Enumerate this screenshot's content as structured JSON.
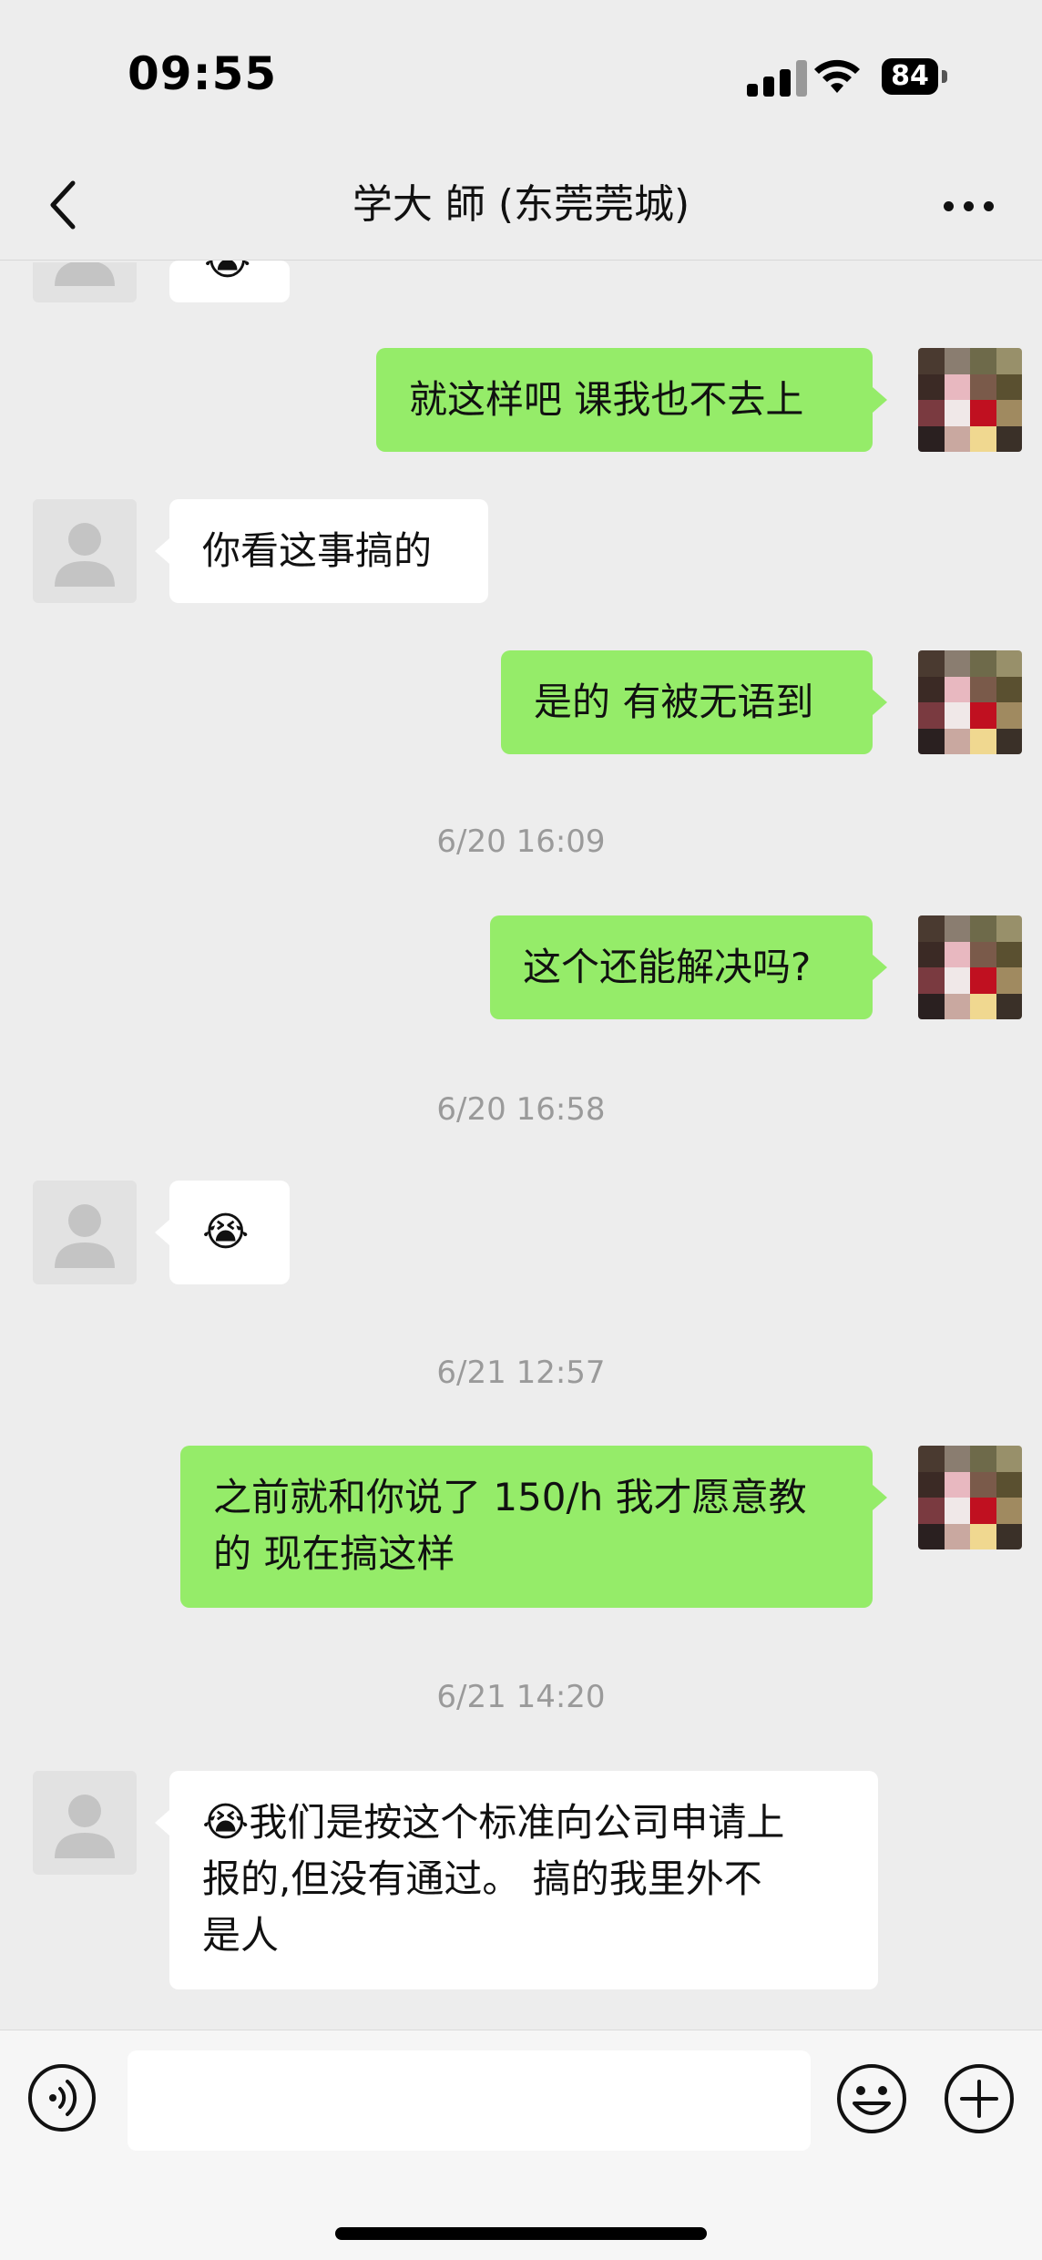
{
  "status_bar": {
    "time": "09:55",
    "battery": "84"
  },
  "nav": {
    "title": "学大 師 (东莞莞城)"
  },
  "messages": {
    "m0_emoji": "😭",
    "m1": "就这样吧 课我也不去上",
    "m2": "你看这事搞的",
    "m3": "是的 有被无语到",
    "ts1": "6/20 16:09",
    "m4": "这个还能解决吗?",
    "ts2": "6/20 16:58",
    "m5_emoji": "😭",
    "ts3": "6/21 12:57",
    "m6_line1": "之前就和你说了 150/h 我才愿意教",
    "m6_line2": "的 现在搞这样",
    "ts4": "6/21 14:20",
    "m7_emoji": "😭",
    "m7_line1": "我们是按这个标准向公司申请上",
    "m7_line2": "报的,但没有通过。 搞的我里外不",
    "m7_line3": "是人"
  },
  "input": {
    "placeholder": ""
  },
  "icons": {
    "back": "chevron-left-icon",
    "more": "more-dots-icon",
    "voice": "voice-icon",
    "emoji": "emoji-icon",
    "plus": "plus-icon"
  },
  "colors": {
    "outgoing_bubble": "#95ec69",
    "incoming_bubble": "#ffffff",
    "background": "#ededed"
  }
}
